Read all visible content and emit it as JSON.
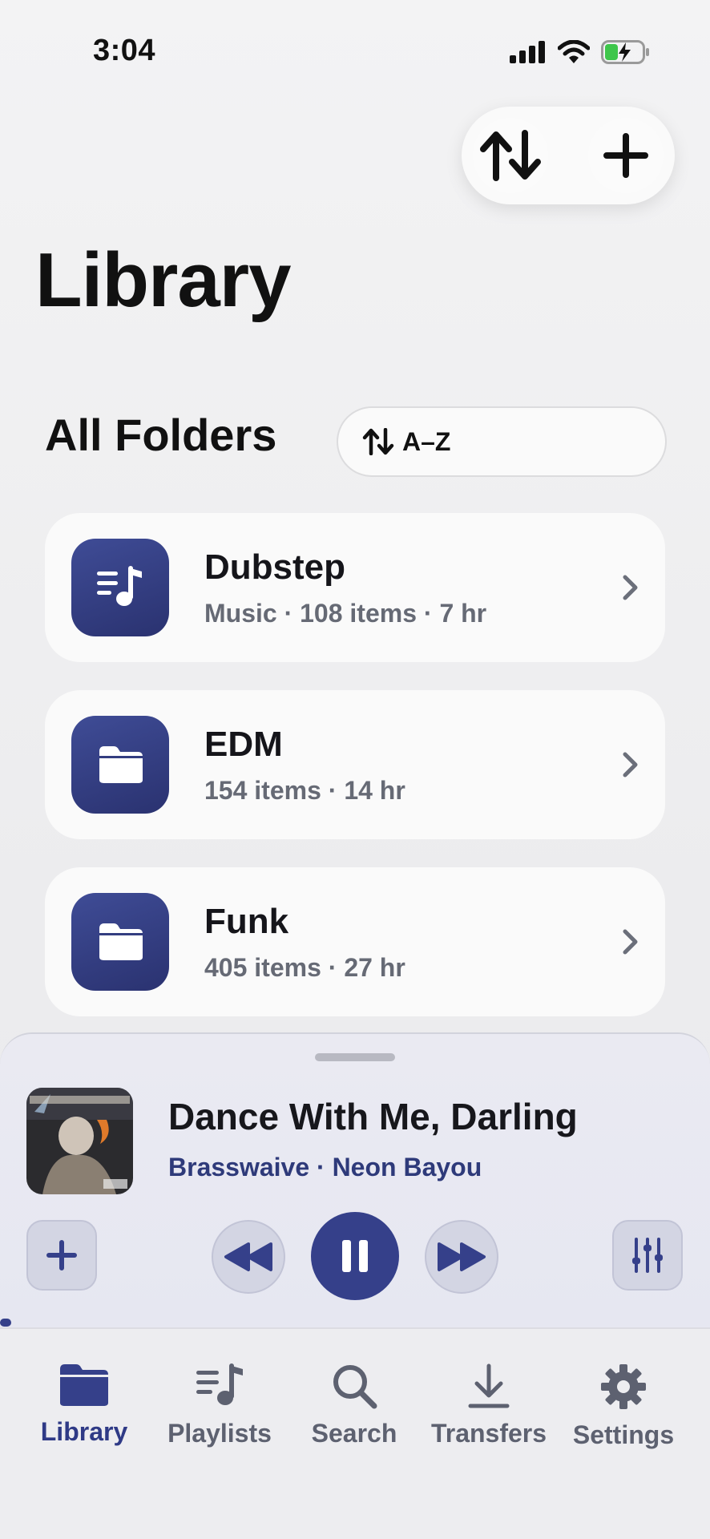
{
  "status_bar": {
    "time": "3:04"
  },
  "page": {
    "title": "Library"
  },
  "section": {
    "title": "All Folders",
    "sort_label": "A–Z"
  },
  "folders": [
    {
      "name": "Dubstep",
      "meta": "Music · 108 items · 7 hr",
      "icon": "music-list-icon"
    },
    {
      "name": "EDM",
      "meta": "154 items · 14 hr",
      "icon": "folder-icon"
    },
    {
      "name": "Funk",
      "meta": "405 items · 27 hr",
      "icon": "folder-icon"
    }
  ],
  "now_playing": {
    "title": "Dance With Me, Darling",
    "subtitle": "Brasswaive · Neon Bayou",
    "progress": 0.01
  },
  "tabs": [
    {
      "label": "Library",
      "icon": "folder-icon",
      "active": true
    },
    {
      "label": "Playlists",
      "icon": "playlist-icon",
      "active": false
    },
    {
      "label": "Search",
      "icon": "search-icon",
      "active": false
    },
    {
      "label": "Transfers",
      "icon": "download-icon",
      "active": false
    },
    {
      "label": "Settings",
      "icon": "gear-icon",
      "active": false
    }
  ],
  "colors": {
    "accent": "#35408a",
    "tile": "#333d80",
    "inactive_tab": "#5d6170"
  }
}
